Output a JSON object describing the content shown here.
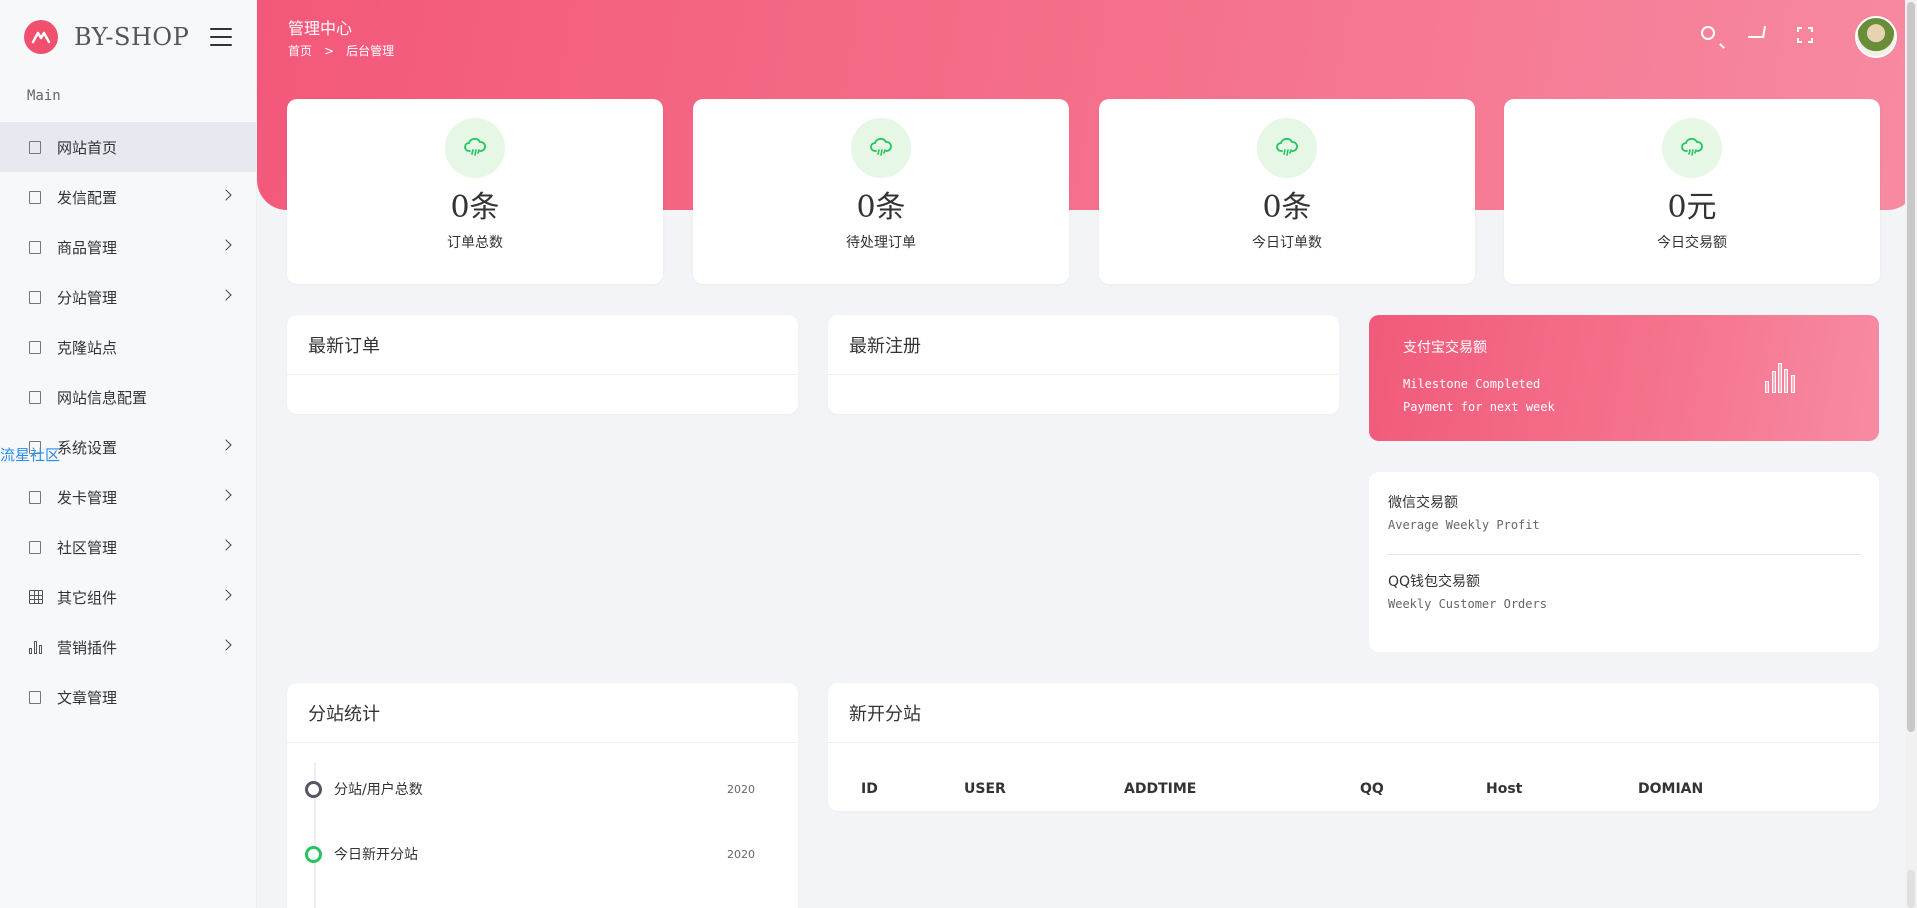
{
  "brand": {
    "name": "BY-SHOP"
  },
  "sidebar": {
    "section": "Main",
    "items": [
      {
        "label": "网站首页",
        "icon": "square-icon",
        "expandable": false,
        "active": true
      },
      {
        "label": "发信配置",
        "icon": "square-icon",
        "expandable": true
      },
      {
        "label": "商品管理",
        "icon": "square-icon",
        "expandable": true
      },
      {
        "label": "分站管理",
        "icon": "square-icon",
        "expandable": true
      },
      {
        "label": "克隆站点",
        "icon": "square-icon",
        "expandable": false
      },
      {
        "label": "网站信息配置",
        "icon": "square-icon",
        "expandable": false
      },
      {
        "label": "系统设置",
        "icon": "square-icon",
        "expandable": true
      },
      {
        "label": "发卡管理",
        "icon": "square-icon",
        "expandable": true
      },
      {
        "label": "社区管理",
        "icon": "square-icon",
        "expandable": true
      },
      {
        "label": "其它组件",
        "icon": "grid-icon",
        "expandable": true
      },
      {
        "label": "营销插件",
        "icon": "bar-chart-icon",
        "expandable": true
      },
      {
        "label": "文章管理",
        "icon": "square-icon",
        "expandable": false
      }
    ],
    "overlay_text": "流星社区"
  },
  "header": {
    "title": "管理中心",
    "breadcrumb": [
      "首页",
      "后台管理"
    ],
    "breadcrumb_sep": ">",
    "icons": [
      "search-icon",
      "cart-icon",
      "fullscreen-icon"
    ]
  },
  "stats": [
    {
      "value": "0条",
      "label": "订单总数"
    },
    {
      "value": "0条",
      "label": "待处理订单"
    },
    {
      "value": "0条",
      "label": "今日订单数"
    },
    {
      "value": "0元",
      "label": "今日交易额"
    }
  ],
  "panels": {
    "latest_orders": "最新订单",
    "latest_registrations": "最新注册",
    "substation_stats": "分站统计",
    "new_substations": "新开分站"
  },
  "alipay_card": {
    "title": "支付宝交易额",
    "line1": "Milestone Completed",
    "line2": "Payment for next week"
  },
  "info_card": {
    "wechat_title": "微信交易额",
    "wechat_sub": "Average Weekly Profit",
    "qq_title": "QQ钱包交易额",
    "qq_sub": "Weekly Customer Orders"
  },
  "timeline": [
    {
      "label": "分站/用户总数",
      "date": "2020"
    },
    {
      "label": "今日新开分站",
      "date": "2020"
    }
  ],
  "table": {
    "columns": [
      "ID",
      "USER",
      "ADDTIME",
      "QQ",
      "Host",
      "DOMIAN"
    ]
  },
  "colors": {
    "accent": "#f3587a",
    "icon_bg": "#e6f7e6",
    "icon_fg": "#22c55e"
  }
}
